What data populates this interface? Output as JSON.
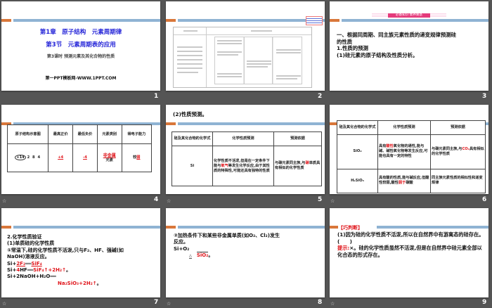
{
  "slides": [
    {
      "number": "1",
      "title1": "第1章　原子结构　元素周期律",
      "title2": "第3节　元素周期表的应用",
      "subtitle": "第3课时 预测元素及其化合物的性质",
      "footer": "第一PPT模板网-WWW.1PPT.COM"
    },
    {
      "number": "2"
    },
    {
      "number": "3",
      "banner": "必备知识·素养奠基",
      "lines": [
        "一、根据同周期、同主族元素性质的递变规律预测硅",
        "的性质",
        "1.性质的预测",
        "(1)硅元素的原子结构及性质分析。"
      ]
    },
    {
      "number": "4",
      "headers": [
        "原子结构示意图",
        "最高正价",
        "最低负价",
        "元素类别",
        "得电子能力"
      ],
      "atom": "+14",
      "shells": "2 8 4",
      "max_valence": "+4",
      "min_valence": "-4",
      "category_answer": "非金属",
      "category_suffix": "元素",
      "ability_prefix": "较",
      "ability_answer": "弱"
    },
    {
      "number": "5",
      "title": "(2)性质预测。",
      "headers": [
        "硅及其化合物的化学式",
        "化学性质预测",
        "预测依据"
      ],
      "formula": "Si",
      "prediction_a": "化学性质不活泼,但是在一定条件下能与",
      "prediction_answer": "氧气",
      "prediction_b": "等发生化学反应,由于其性质的特殊性,可能还具有独特的性质",
      "basis_a": "与碳元素同主族,与",
      "basis_answer": "碳",
      "basis_b": "单质具有相似的化学性质"
    },
    {
      "number": "6",
      "headers": [
        "硅及其化合物的化学式",
        "化学性质预测",
        "预测依据"
      ],
      "rows": [
        {
          "formula": "SiO₂",
          "pred_a": "具有",
          "pred_answer": "酸性",
          "pred_b": "氧化物的通性,能与碱、碱性氧化物等发生反应,可能也具有一定的特性",
          "basis_a": "与碳元素同主族,与",
          "basis_answer": "CO₂",
          "basis_b": "具有相似的化学性质"
        },
        {
          "formula": "H₂SiO₃",
          "pred_a": "具有酸的性质,能与碱反应,但酸性较弱,酸性",
          "pred_answer": "弱于",
          "pred_b": "碳酸",
          "basis": "同主族元素性质的相似性和递变规律"
        }
      ]
    },
    {
      "number": "7",
      "lines": [
        "2.化学性质验证",
        "(1)单质硅的化学性质",
        "①常温下,硅的化学性质不活泼,只与F₂、HF、强碱(如",
        "NaOH)溶液反应。"
      ],
      "eq1": "Si+",
      "eq1_ans": "2F₂",
      "eq1_prod": "SiF₄",
      "eq2": "Si+",
      "eq2_ans": "4",
      "eq2_b": "HF",
      "eq2_prod": "SiF₄↑+2H₂↑",
      "eq3": "Si+2NaOH+H₂O",
      "eq3_prod": "Na₂SiO₃+2H₂↑"
    },
    {
      "number": "8",
      "lines": [
        "②加热条件下和某些非金属单质(如O₂、Cl₂)发生",
        "反应。"
      ],
      "eq": "Si+O₂",
      "cond": "△",
      "prod": "SiO₂"
    },
    {
      "number": "9",
      "tag": "【巧判断】",
      "q": "(1)因为硅的化学性质不活泼,所以在自然界中有游离态的硅存在。　(　　)",
      "hint_label": "提示:",
      "hint": "×。硅的化学性质虽然不活泼,但是在自然界中硅元素全部以化合态的形式存在。"
    }
  ]
}
